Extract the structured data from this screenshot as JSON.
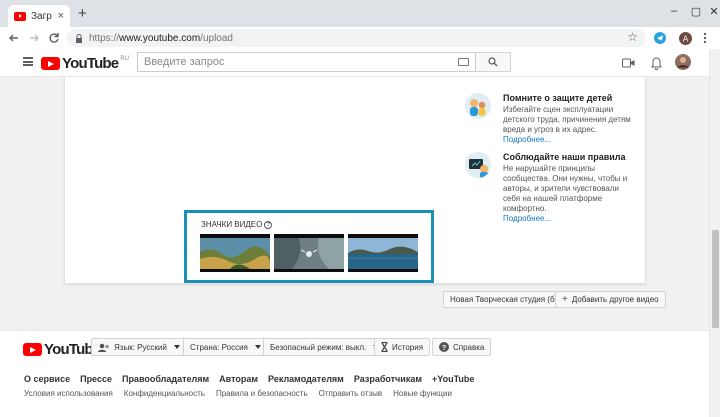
{
  "browser": {
    "tab_title": "Загр",
    "tab_close": "×",
    "new_tab": "+",
    "url_scheme": "https://",
    "url_host": "www.youtube.com",
    "url_path": "/upload",
    "profile_initial": "A",
    "window_controls": [
      "–",
      "▢",
      "✕"
    ]
  },
  "header": {
    "logo_text": "YouTube",
    "region": "RU",
    "search_placeholder": "Введите запрос"
  },
  "tips": [
    {
      "title": "Помните о защите детей",
      "body": "Избегайте сцен эксплуатации детского труда, причинения детям вреда и угроз в их адрес.",
      "more": "Подробнее..."
    },
    {
      "title": "Соблюдайте наши правила",
      "body": "Не нарушайте принципы сообщества. Они нужны, чтобы и авторы, и зрители чувствовали себя на нашей платформе комфортно.",
      "more": "Подробнее..."
    }
  ],
  "thumbnails": {
    "label": "ЗНАЧКИ ВИДЕО",
    "help": "?"
  },
  "actions": {
    "creator_studio": "Новая Творческая студия (бета)",
    "add_video": "Добавить другое видео"
  },
  "footer": {
    "logo_text": "YouTube",
    "language": "Язык: Русский",
    "country": "Страна: Россия",
    "safe_mode": "Безопасный режим: выкл.",
    "history": "История",
    "help": "Справка",
    "links_primary": [
      "О сервисе",
      "Прессе",
      "Правообладателям",
      "Авторам",
      "Рекламодателям",
      "Разработчикам",
      "+YouTube"
    ],
    "links_secondary": [
      "Условия использования",
      "Конфиденциальность",
      "Правила и безопасность",
      "Отправить отзыв",
      "Новые функции"
    ]
  },
  "colors": {
    "accent_border": "#1c8fb6",
    "link": "#167ac6",
    "brand_red": "#ff0000"
  }
}
